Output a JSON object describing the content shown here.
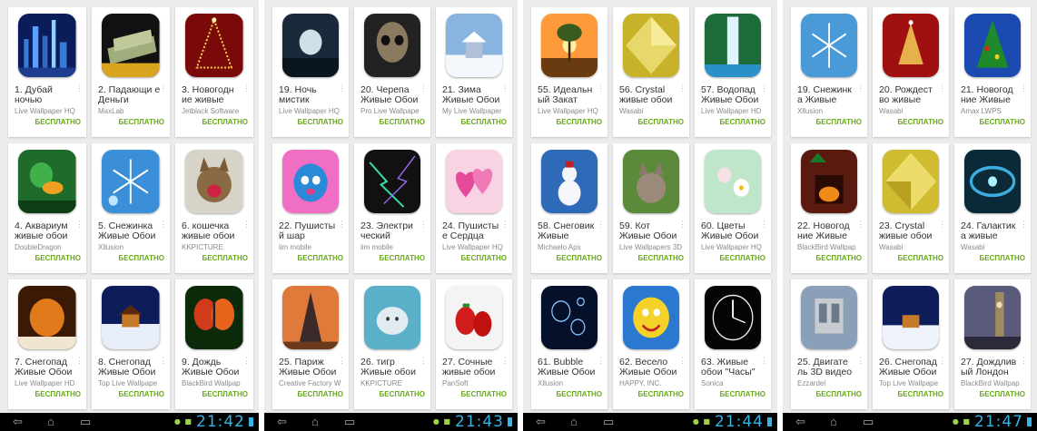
{
  "panels": [
    {
      "time": "21:42",
      "apps": [
        {
          "title": "1. Дубай ночью",
          "dev": "Live Wallpaper HQ",
          "price": "БЕСПЛАТНО",
          "icon": "city-night"
        },
        {
          "title": "2. Падающи е Деньги",
          "dev": "MaxLab",
          "price": "БЕСПЛАТНО",
          "icon": "money"
        },
        {
          "title": "3. Новогодн ие живые",
          "dev": "Jetblack Software",
          "price": "БЕСПЛАТНО",
          "icon": "christmas-tree"
        },
        {
          "title": "4. Аквариум живые обои",
          "dev": "DoubleDragon",
          "price": "БЕСПЛАТНО",
          "icon": "aquarium"
        },
        {
          "title": "5. Снежинка Живые Обои",
          "dev": "Xllusion",
          "price": "БЕСПЛАТНО",
          "icon": "snowflake"
        },
        {
          "title": "6. кошечка живые обои",
          "dev": "KKPICTURE",
          "price": "БЕСПЛАТНО",
          "icon": "kitten"
        },
        {
          "title": "7. Снегопад Живые Обои",
          "dev": "Live Wallpaper HD",
          "price": "БЕСПЛАТНО",
          "icon": "snowfall-window"
        },
        {
          "title": "8. Снегопад Живые Обои",
          "dev": "Top Live Wallpape",
          "price": "БЕСПЛАТНО",
          "icon": "snow-house"
        },
        {
          "title": "9. Дождь Живые Обои",
          "dev": "BlackBird Wallpap",
          "price": "БЕСПЛАТНО",
          "icon": "butterfly"
        }
      ]
    },
    {
      "time": "21:43",
      "apps": [
        {
          "title": "19. Ночь мистик",
          "dev": "Live Wallpaper HQ",
          "price": "БЕСПЛАТНО",
          "icon": "mystic-moon"
        },
        {
          "title": "20. Черепа Живые Обои",
          "dev": "Pro Live Wallpape",
          "price": "БЕСПЛАТНО",
          "icon": "skull"
        },
        {
          "title": "21. Зима Живые Обои",
          "dev": "My Live Wallpaper",
          "price": "БЕСПЛАТНО",
          "icon": "winter-house"
        },
        {
          "title": "22. Пушисты й шар",
          "dev": "iim mobile",
          "price": "БЕСПЛАТНО",
          "icon": "fluffy-ball"
        },
        {
          "title": "23. Электри ческий",
          "dev": "iim mobile",
          "price": "БЕСПЛАТНО",
          "icon": "electric"
        },
        {
          "title": "24. Пушисты е Сердца",
          "dev": "Live Wallpaper HQ",
          "price": "БЕСПЛАТНО",
          "icon": "hearts"
        },
        {
          "title": "25. Париж Живые Обои",
          "dev": "Creative Factory W",
          "price": "БЕСПЛАТНО",
          "icon": "eiffel"
        },
        {
          "title": "26. тигр Живые обои",
          "dev": "KKPICTURE",
          "price": "БЕСПЛАТНО",
          "icon": "tiger"
        },
        {
          "title": "27. Сочные живые обои",
          "dev": "PanSoft",
          "price": "БЕСПЛАТНО",
          "icon": "strawberries"
        }
      ]
    },
    {
      "time": "21:44",
      "apps": [
        {
          "title": "55. Идеальн ый Закат",
          "dev": "Live Wallpaper HQ",
          "price": "БЕСПЛАТНО",
          "icon": "sunset"
        },
        {
          "title": "56. Crystal живые обои",
          "dev": "Wasabi",
          "price": "БЕСПЛАТНО",
          "icon": "crystal"
        },
        {
          "title": "57. Водопад Живые Обои",
          "dev": "Live Wallpaper HD",
          "price": "БЕСПЛАТНО",
          "icon": "waterfall"
        },
        {
          "title": "58. Снеговик Живые",
          "dev": "Michaelo Aps",
          "price": "БЕСПЛАТНО",
          "icon": "snowman"
        },
        {
          "title": "59. Кот Живые Обои",
          "dev": "Live Wallpapers 3D",
          "price": "БЕСПЛАТНО",
          "icon": "cat"
        },
        {
          "title": "60. Цветы Живые Обои",
          "dev": "Live Wallpaper HQ",
          "price": "БЕСПЛАТНО",
          "icon": "flowers"
        },
        {
          "title": "61. Bubble Живые Обои",
          "dev": "Xllusion",
          "price": "БЕСПЛАТНО",
          "icon": "bubbles"
        },
        {
          "title": "62. Весело Живые Обои",
          "dev": "HAPPY, INC.",
          "price": "БЕСПЛАТНО",
          "icon": "smiley"
        },
        {
          "title": "63. Живые обои \"Часы\"",
          "dev": "Sonica",
          "price": "БЕСПЛАТНО",
          "icon": "clock"
        }
      ]
    },
    {
      "time": "21:47",
      "apps": [
        {
          "title": "19. Снежинк а Живые",
          "dev": "Xllusion",
          "price": "БЕСПЛАТНО",
          "icon": "snowflake-2"
        },
        {
          "title": "20. Рождест во живые",
          "dev": "Wasabi",
          "price": "БЕСПЛАТНО",
          "icon": "christmas-red"
        },
        {
          "title": "21. Новогод ние Живые",
          "dev": "Amax LWPS",
          "price": "БЕСПЛАТНО",
          "icon": "xmas-tree-blue"
        },
        {
          "title": "22. Новогод ние Живые",
          "dev": "BlackBird Wallpap",
          "price": "БЕСПЛАТНО",
          "icon": "fireplace"
        },
        {
          "title": "23. Crystal живые обои",
          "dev": "Wasabi",
          "price": "БЕСПЛАТНО",
          "icon": "crystal-2"
        },
        {
          "title": "24. Галактик а живые",
          "dev": "Wasabi",
          "price": "БЕСПЛАТНО",
          "icon": "galaxy"
        },
        {
          "title": "25. Двигате ль 3D видео",
          "dev": "Ezzardel",
          "price": "БЕСПЛАТНО",
          "icon": "engine"
        },
        {
          "title": "26. Снегопад Живые Обои",
          "dev": "Top Live Wallpape",
          "price": "БЕСПЛАТНО",
          "icon": "snow-house-2"
        },
        {
          "title": "27. Дождлив ый Лондон",
          "dev": "BlackBird Wallpap",
          "price": "БЕСПЛАТНО",
          "icon": "london"
        }
      ]
    }
  ],
  "nav": {
    "back": "back-icon",
    "home": "home-icon",
    "recent": "recent-apps-icon"
  },
  "colors": {
    "accent": "#35b5e5",
    "price": "#69a81c"
  }
}
